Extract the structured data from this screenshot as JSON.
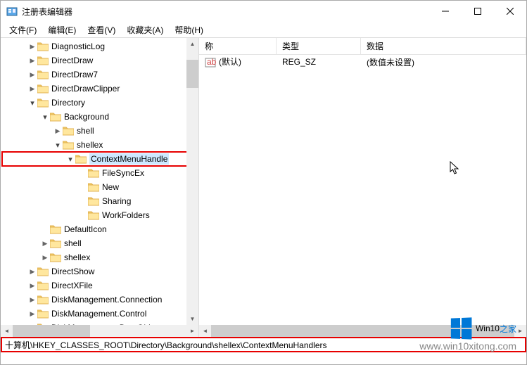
{
  "window": {
    "title": "注册表编辑器"
  },
  "menu": {
    "file": "文件(F)",
    "edit": "编辑(E)",
    "view": "查看(V)",
    "favorites": "收藏夹(A)",
    "help": "帮助(H)"
  },
  "tree": {
    "items": [
      {
        "indent": 2,
        "exp": "closed",
        "label": "DiagnosticLog"
      },
      {
        "indent": 2,
        "exp": "closed",
        "label": "DirectDraw"
      },
      {
        "indent": 2,
        "exp": "closed",
        "label": "DirectDraw7"
      },
      {
        "indent": 2,
        "exp": "closed",
        "label": "DirectDrawClipper"
      },
      {
        "indent": 2,
        "exp": "open",
        "label": "Directory"
      },
      {
        "indent": 3,
        "exp": "open",
        "label": "Background"
      },
      {
        "indent": 4,
        "exp": "closed",
        "label": "shell"
      },
      {
        "indent": 4,
        "exp": "open",
        "label": "shellex"
      },
      {
        "indent": 5,
        "exp": "open",
        "label": "ContextMenuHandle",
        "highlight": true,
        "selected": true
      },
      {
        "indent": 6,
        "exp": "none",
        "label": "FileSyncEx"
      },
      {
        "indent": 6,
        "exp": "none",
        "label": "New"
      },
      {
        "indent": 6,
        "exp": "none",
        "label": "Sharing"
      },
      {
        "indent": 6,
        "exp": "none",
        "label": "WorkFolders"
      },
      {
        "indent": 3,
        "exp": "none",
        "label": "DefaultIcon"
      },
      {
        "indent": 3,
        "exp": "closed",
        "label": "shell"
      },
      {
        "indent": 3,
        "exp": "closed",
        "label": "shellex"
      },
      {
        "indent": 2,
        "exp": "closed",
        "label": "DirectShow"
      },
      {
        "indent": 2,
        "exp": "closed",
        "label": "DirectXFile"
      },
      {
        "indent": 2,
        "exp": "closed",
        "label": "DiskManagement.Connection"
      },
      {
        "indent": 2,
        "exp": "closed",
        "label": "DiskManagement.Control"
      },
      {
        "indent": 2,
        "exp": "closed",
        "label": "DiskManagement.DataObject"
      }
    ]
  },
  "list": {
    "columns": {
      "name": "称",
      "type": "类型",
      "data": "数据"
    },
    "rows": [
      {
        "name": "(默认)",
        "type": "REG_SZ",
        "data": "(数值未设置)"
      }
    ]
  },
  "statusbar": {
    "path": "十算机\\HKEY_CLASSES_ROOT\\Directory\\Background\\shellex\\ContextMenuHandlers"
  },
  "watermark": {
    "brand_a": "Win10",
    "brand_b": "之家",
    "url": "www.win10xitong.com"
  }
}
